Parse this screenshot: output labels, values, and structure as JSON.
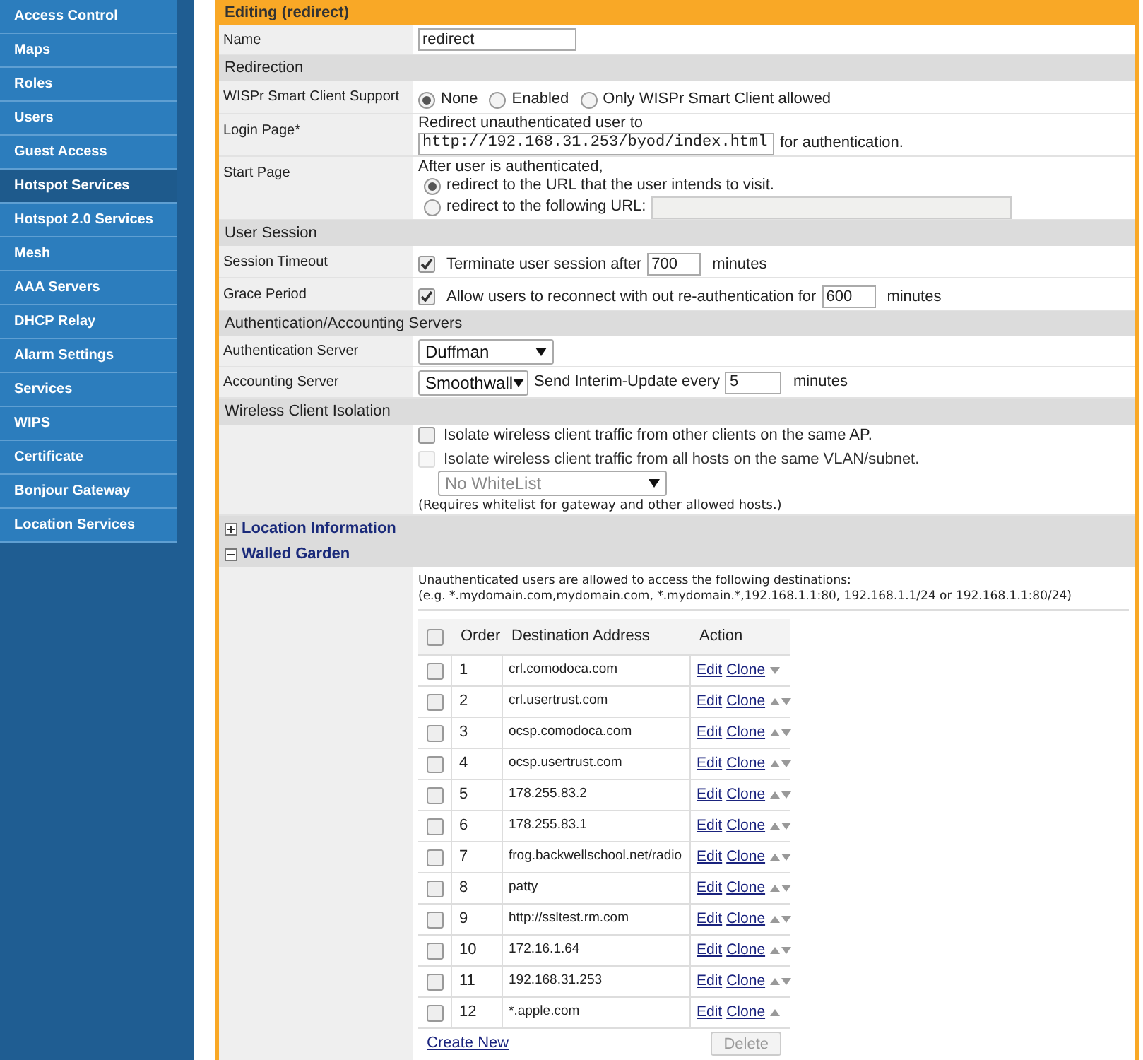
{
  "sidebar": {
    "items": [
      {
        "label": "Access Control",
        "selected": false
      },
      {
        "label": "Maps",
        "selected": false
      },
      {
        "label": "Roles",
        "selected": false
      },
      {
        "label": "Users",
        "selected": false
      },
      {
        "label": "Guest Access",
        "selected": false
      },
      {
        "label": "Hotspot Services",
        "selected": true
      },
      {
        "label": "Hotspot 2.0 Services",
        "selected": false
      },
      {
        "label": "Mesh",
        "selected": false
      },
      {
        "label": "AAA Servers",
        "selected": false
      },
      {
        "label": "DHCP Relay",
        "selected": false
      },
      {
        "label": "Alarm Settings",
        "selected": false
      },
      {
        "label": "Services",
        "selected": false
      },
      {
        "label": "WIPS",
        "selected": false
      },
      {
        "label": "Certificate",
        "selected": false
      },
      {
        "label": "Bonjour Gateway",
        "selected": false
      },
      {
        "label": "Location Services",
        "selected": false
      }
    ]
  },
  "editor": {
    "title": "Editing (redirect)",
    "name_row": {
      "label": "Name",
      "value": "redirect"
    },
    "redirection": {
      "heading": "Redirection",
      "wispr": {
        "label": "WISPr Smart Client Support",
        "options": [
          {
            "label": "None",
            "selected": true
          },
          {
            "label": "Enabled",
            "selected": false
          },
          {
            "label": "Only WISPr Smart Client allowed",
            "selected": false
          }
        ]
      },
      "login_page": {
        "label": "Login Page*",
        "intro": "Redirect unauthenticated user to",
        "url": "http://192.168.31.253/byod/index.html",
        "suffix": "for authentication."
      },
      "start_page": {
        "label": "Start Page",
        "intro": "After user is authenticated,",
        "options": [
          {
            "label": "redirect to the URL that the user intends to visit.",
            "selected": true
          },
          {
            "label": "redirect to the following URL:",
            "selected": false
          }
        ],
        "url_field": {
          "disabled": true
        }
      }
    },
    "user_session": {
      "heading": "User Session",
      "rows": [
        {
          "label": "Session Timeout",
          "checked": true,
          "before": "Terminate user session after",
          "value": "700",
          "after": "minutes"
        },
        {
          "label": "Grace Period",
          "checked": true,
          "before": "Allow users to reconnect with out re-authentication for",
          "value": "600",
          "after": "minutes"
        }
      ]
    },
    "servers": {
      "heading": "Authentication/Accounting Servers",
      "auth": {
        "label": "Authentication Server",
        "value": "Duffman"
      },
      "accounting": {
        "label": "Accounting Server",
        "value": "Smoothwall",
        "before": "Send Interim-Update every",
        "interval": "5",
        "after": "minutes"
      }
    },
    "isolation": {
      "heading": "Wireless Client Isolation",
      "options": [
        {
          "label": "Isolate wireless client traffic from other clients on the same AP.",
          "checked": false,
          "disabled": false
        },
        {
          "label": "Isolate wireless client traffic from all hosts on the same VLAN/subnet.",
          "checked": false,
          "disabled": true
        }
      ],
      "whitelist": {
        "value": "No WhiteList",
        "disabled": true
      },
      "note": "(Requires whitelist for gateway and other allowed hosts.)"
    },
    "location": {
      "heading": "Location Information",
      "expanded": false
    },
    "walled_garden": {
      "heading": "Walled Garden",
      "expanded": true,
      "intro": "Unauthenticated users are allowed to access the following destinations:",
      "example": "(e.g. *.mydomain.com,mydomain.com, *.mydomain.*,192.168.1.1:80, 192.168.1.1/24 or 192.168.1.1:80/24)",
      "table": {
        "select_all": false,
        "columns": [
          "Order",
          "Destination Address",
          "Action"
        ],
        "rows": [
          {
            "checked": false,
            "order": "1",
            "address": "crl.comodoca.com",
            "edit": "Edit",
            "clone": "Clone",
            "move_up": false,
            "move_down": true
          },
          {
            "checked": false,
            "order": "2",
            "address": "crl.usertrust.com",
            "edit": "Edit",
            "clone": "Clone",
            "move_up": true,
            "move_down": true
          },
          {
            "checked": false,
            "order": "3",
            "address": "ocsp.comodoca.com",
            "edit": "Edit",
            "clone": "Clone",
            "move_up": true,
            "move_down": true
          },
          {
            "checked": false,
            "order": "4",
            "address": "ocsp.usertrust.com",
            "edit": "Edit",
            "clone": "Clone",
            "move_up": true,
            "move_down": true
          },
          {
            "checked": false,
            "order": "5",
            "address": "178.255.83.2",
            "edit": "Edit",
            "clone": "Clone",
            "move_up": true,
            "move_down": true
          },
          {
            "checked": false,
            "order": "6",
            "address": "178.255.83.1",
            "edit": "Edit",
            "clone": "Clone",
            "move_up": true,
            "move_down": true
          },
          {
            "checked": false,
            "order": "7",
            "address": "frog.backwellschool.net/radio",
            "edit": "Edit",
            "clone": "Clone",
            "move_up": true,
            "move_down": true
          },
          {
            "checked": false,
            "order": "8",
            "address": "patty",
            "edit": "Edit",
            "clone": "Clone",
            "move_up": true,
            "move_down": true
          },
          {
            "checked": false,
            "order": "9",
            "address": "http://ssltest.rm.com",
            "edit": "Edit",
            "clone": "Clone",
            "move_up": true,
            "move_down": true
          },
          {
            "checked": false,
            "order": "10",
            "address": "172.16.1.64",
            "edit": "Edit",
            "clone": "Clone",
            "move_up": true,
            "move_down": true
          },
          {
            "checked": false,
            "order": "11",
            "address": "192.168.31.253",
            "edit": "Edit",
            "clone": "Clone",
            "move_up": true,
            "move_down": true
          },
          {
            "checked": false,
            "order": "12",
            "address": "*.apple.com",
            "edit": "Edit",
            "clone": "Clone",
            "move_up": true,
            "move_down": false
          }
        ]
      },
      "create_new": "Create New",
      "delete": {
        "label": "Delete",
        "disabled": true
      }
    }
  }
}
